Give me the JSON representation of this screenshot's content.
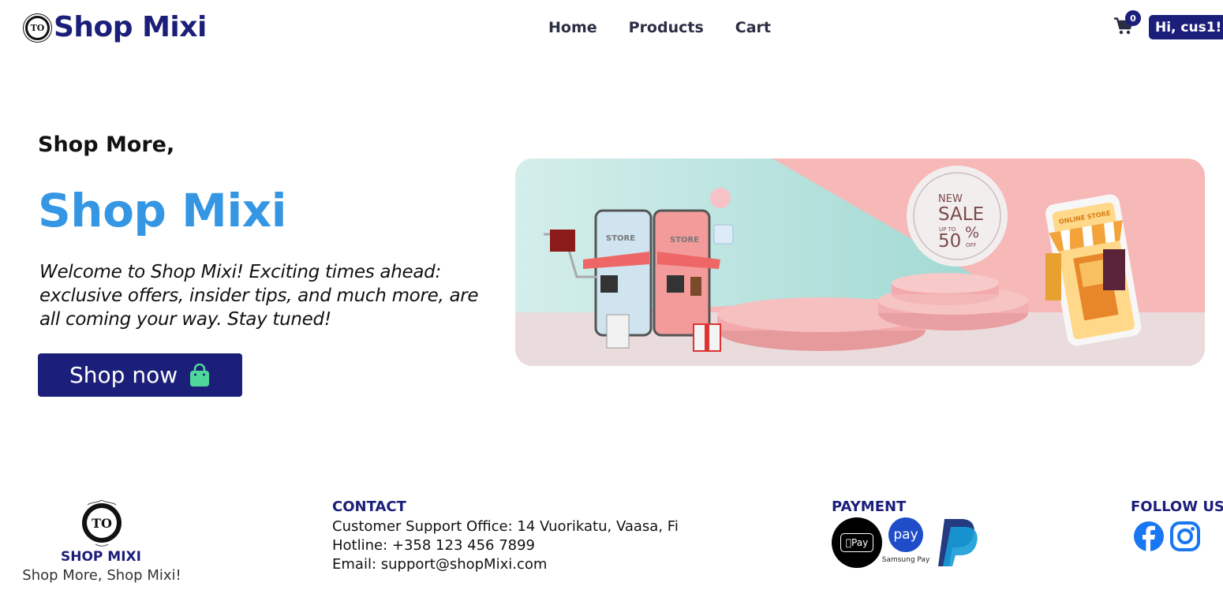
{
  "header": {
    "brand": "Shop Mixi",
    "logo_text": "TO",
    "nav": [
      "Home",
      "Products",
      "Cart"
    ],
    "cart_count": "0",
    "user_greeting": "Hi, cus1!"
  },
  "hero": {
    "kicker": "Shop More,",
    "title": "Shop Mixi",
    "description": "Welcome to Shop Mixi! Exciting times ahead: exclusive offers, insider tips, and much more, are all coming your way. Stay tuned!",
    "cta_label": "Shop now",
    "banner": {
      "store_label_1": "STORE",
      "store_label_2": "STORE",
      "sale_new": "NEW",
      "sale_word": "SALE",
      "sale_upto": "UP TO",
      "sale_percent": "50",
      "sale_percent_sign": "%",
      "sale_off": "OFF",
      "online_store": "ONLINE STORE"
    }
  },
  "footer": {
    "brand": "SHOP MIXI",
    "tagline": "Shop More, Shop Mixi!",
    "contact": {
      "heading": "CONTACT",
      "office": "Customer Support Office: 14 Vuorikatu, Vaasa, Fi",
      "hotline": "Hotline: +358 123 456 7899",
      "email": "Email: support@shopMixi.com"
    },
    "payment": {
      "heading": "PAYMENT",
      "apple_pay": "Pay",
      "samsung_circle": "pay",
      "samsung_caption": "Samsung Pay"
    },
    "follow": {
      "heading": "FOLLOW US"
    }
  },
  "colors": {
    "brand_navy": "#1b1f7a",
    "hero_blue": "#3596e3",
    "bag_green": "#4fd89a",
    "facebook": "#1877f2",
    "instagram": "#1877f2"
  },
  "icons": [
    "cart-icon",
    "shopping-bag-icon",
    "apple-pay-icon",
    "samsung-pay-icon",
    "paypal-icon",
    "facebook-icon",
    "instagram-icon"
  ]
}
